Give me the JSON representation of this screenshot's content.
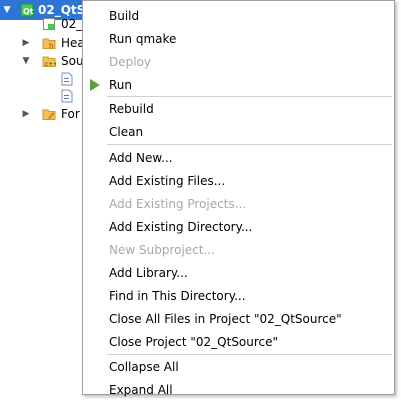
{
  "tree": {
    "project": "02_QtS",
    "pro_file": "02_",
    "headers": "Hea",
    "sources": "Sou",
    "forms": "For"
  },
  "menu": {
    "build": "Build",
    "run_qmake": "Run qmake",
    "deploy": "Deploy",
    "run": "Run",
    "rebuild": "Rebuild",
    "clean": "Clean",
    "add_new": "Add New...",
    "add_existing_files": "Add Existing Files...",
    "add_existing_projects": "Add Existing Projects...",
    "add_existing_directory": "Add Existing Directory...",
    "new_subproject": "New Subproject...",
    "add_library": "Add Library...",
    "find_in_directory": "Find in This Directory...",
    "close_all_files": "Close All Files in Project \"02_QtSource\"",
    "close_project": "Close Project \"02_QtSource\"",
    "collapse_all": "Collapse All",
    "expand_all": "Expand All"
  },
  "colors": {
    "selection": "#2e75d6",
    "run_icon": "#5aa13a",
    "disabled_text": "#a8a8a8"
  }
}
